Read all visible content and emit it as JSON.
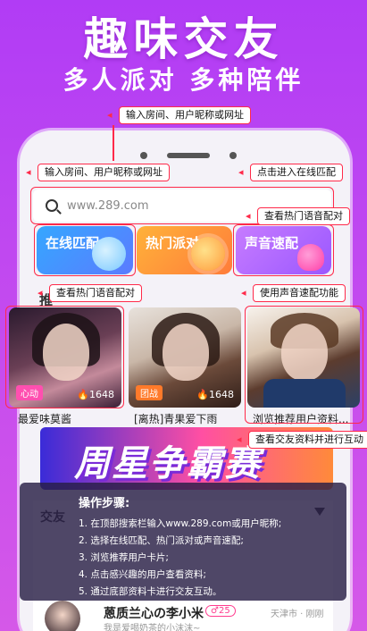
{
  "hero": {
    "title": "趣味交友",
    "subtitle": "多人派对 多种陪伴"
  },
  "search": {
    "placeholder": "www.289.com"
  },
  "categories": [
    {
      "label": "在线匹配",
      "color": "#35a7ff"
    },
    {
      "label": "热门派对",
      "color": "#ffb23a"
    },
    {
      "label": "声音速配",
      "color": "#c77cff"
    }
  ],
  "section": {
    "recommend_label": "推"
  },
  "cards": [
    {
      "tag": "心动",
      "count": "1648",
      "title": "最爱味莫酱"
    },
    {
      "tag": "团战",
      "count": "1648",
      "title": "[离热]青果爱下雨"
    },
    {
      "tag": "",
      "count": "",
      "title": "浏览推荐用户资料..."
    }
  ],
  "banner": {
    "text": "周星争霸赛"
  },
  "list": {
    "label": "交友",
    "row": {
      "name": "蒽质兰心の李小米",
      "badge": "♂25",
      "location": "天津市 · 刚刚",
      "subtitle": "我是爱喝奶茶的小沫沫~"
    }
  },
  "instructions": {
    "title": "操作步骤:",
    "steps": [
      "1. 在顶部搜索栏输入www.289.com或用户昵称;",
      "2. 选择在线匹配、热门派对或声音速配;",
      "3. 浏览推荐用户卡片;",
      "4. 点击感兴趣的用户查看资料;",
      "5. 通过底部资料卡进行交友互动。"
    ]
  },
  "callouts": {
    "top": "输入房间、用户昵称或网址",
    "search_left": "输入房间、用户昵称或网址",
    "online_match": "点击进入在线匹配",
    "hot_voice_right": "查看热门语音配对",
    "hot_voice_left": "查看热门语音配对",
    "voice_match": "使用声音速配功能",
    "profile": "查看交友资料并进行互动"
  },
  "colors": {
    "accent": "#ff2a4a",
    "background": "#b13cf5"
  }
}
